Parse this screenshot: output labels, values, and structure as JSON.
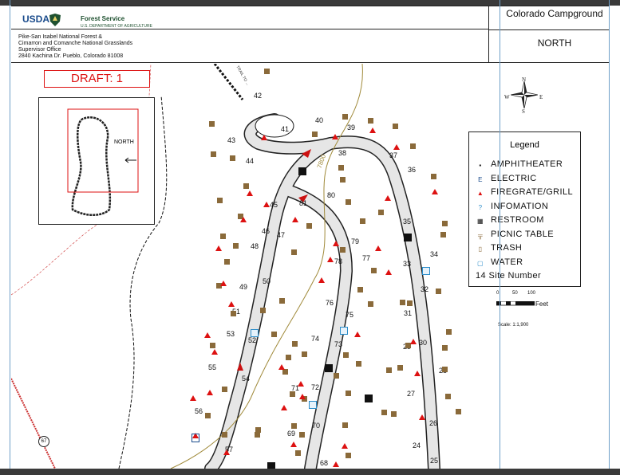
{
  "header": {
    "usda_logo_text": "USDA",
    "agency_name": "Forest Service",
    "agency_dept": "U.S. DEPARTMENT OF AGRICULTURE",
    "forest_name": "Pike-San Isabel National Forest &",
    "grasslands": "Cimarron and Comanche National Grasslands",
    "office": "Supervisor Office",
    "address": "2840 Kachina Dr. Pueblo, Colorado  81008",
    "title": "Colorado Campground",
    "subtitle": "NORTH"
  },
  "map": {
    "draft_label": "DRAFT: 1",
    "inset_label": "NORTH",
    "trail_label": "TRAIL TO ...",
    "road_label": "7800",
    "route_shield": "67",
    "compass": {
      "n": "N",
      "s": "S",
      "e": "E",
      "w": "W"
    },
    "scale": {
      "ticks": [
        "0",
        "50",
        "100"
      ],
      "unit": "Feet",
      "ratio": "Scale: 1:1,900"
    },
    "site_numbers": [
      "24",
      "25",
      "26",
      "27",
      "28",
      "29",
      "30",
      "31",
      "32",
      "33",
      "34",
      "35",
      "36",
      "37",
      "38",
      "39",
      "40",
      "41",
      "42",
      "43",
      "44",
      "45",
      "46",
      "47",
      "48",
      "49",
      "50",
      "51",
      "52",
      "53",
      "54",
      "55",
      "56",
      "57",
      "68",
      "69",
      "70",
      "71",
      "72",
      "73",
      "74",
      "75",
      "76",
      "77",
      "78",
      "79",
      "80",
      "81"
    ]
  },
  "legend": {
    "title": "Legend",
    "items": [
      {
        "label": "AMPHITHEATER",
        "icon": "amphitheater-icon",
        "glyph": "▪"
      },
      {
        "label": "ELECTRIC",
        "icon": "electric-icon",
        "glyph": "E"
      },
      {
        "label": "FIREGRATE/GRILL",
        "icon": "firegrate-icon",
        "glyph": "▲"
      },
      {
        "label": "INFOMATION",
        "icon": "information-icon",
        "glyph": "?"
      },
      {
        "label": "RESTROOM",
        "icon": "restroom-icon",
        "glyph": "▦"
      },
      {
        "label": "PICNIC TABLE",
        "icon": "picnic-table-icon",
        "glyph": "╦"
      },
      {
        "label": "TRASH",
        "icon": "trash-icon",
        "glyph": "▯"
      },
      {
        "label": "WATER",
        "icon": "water-icon",
        "glyph": "▢"
      }
    ],
    "site_number_example": "14 Site Number"
  },
  "colors": {
    "draft_red": "#dd1111",
    "road_gray": "#d8d8d8",
    "trail_brown": "#a08a3a",
    "arrow_red": "#cc1111"
  }
}
